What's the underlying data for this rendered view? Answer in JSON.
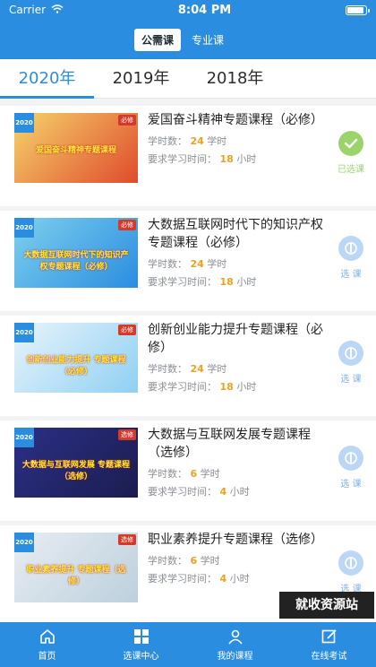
{
  "status": {
    "carrier": "Carrier",
    "time": "8:04 PM"
  },
  "segments": [
    {
      "label": "公需课",
      "active": true
    },
    {
      "label": "专业课",
      "active": false
    }
  ],
  "year_tabs": [
    {
      "label": "2020年",
      "active": true
    },
    {
      "label": "2019年",
      "active": false
    },
    {
      "label": "2018年",
      "active": false
    }
  ],
  "labels": {
    "hours_prefix": "学时数：",
    "hours_unit": "学时",
    "req_prefix": "要求学习时间：",
    "req_unit": "小时"
  },
  "courses": [
    {
      "title": "爱国奋斗精神专题课程（必修）",
      "hours": "24",
      "required": "18",
      "status_label": "已选课",
      "selected": true,
      "thumb_year": "2020",
      "thumb_tag": "必修",
      "thumb_title": "爱国奋斗精神专题课程",
      "thumb_colors": [
        "#f6d46b",
        "#e04b2d"
      ]
    },
    {
      "title": "大数据互联网时代下的知识产权专题课程（必修）",
      "hours": "24",
      "required": "18",
      "status_label": "选 课",
      "selected": false,
      "thumb_year": "2020",
      "thumb_tag": "必修",
      "thumb_title": "大数据互联网时代下的知识产权专题课程（必修）",
      "thumb_colors": [
        "#7ed0ee",
        "#2a8de0"
      ]
    },
    {
      "title": "创新创业能力提升专题课程（必修）",
      "hours": "24",
      "required": "18",
      "status_label": "选 课",
      "selected": false,
      "thumb_year": "2020",
      "thumb_tag": "必修",
      "thumb_title": "创新创业能力提升 专题课程（必修）",
      "thumb_colors": [
        "#e9f4fb",
        "#8fd0f3"
      ]
    },
    {
      "title": "大数据与互联网发展专题课程（选修）",
      "hours": "6",
      "required": "4",
      "status_label": "选 课",
      "selected": false,
      "thumb_year": "2020",
      "thumb_tag": "选修",
      "thumb_title": "大数据与互联网发展 专题课程（选修）",
      "thumb_colors": [
        "#2b2f86",
        "#1b1d4f"
      ]
    },
    {
      "title": "职业素养提升专题课程（选修）",
      "hours": "6",
      "required": "4",
      "status_label": "选 课",
      "selected": false,
      "thumb_year": "2020",
      "thumb_tag": "选修",
      "thumb_title": "职业素养提升 专题课程（选修）",
      "thumb_colors": [
        "#e8edf2",
        "#bcd0dd"
      ]
    }
  ],
  "watermark": "就收资源站",
  "tabbar": [
    {
      "label": "首页",
      "icon": "home-icon"
    },
    {
      "label": "选课中心",
      "icon": "grid-icon"
    },
    {
      "label": "我的课程",
      "icon": "user-icon"
    },
    {
      "label": "在线考试",
      "icon": "edit-icon"
    }
  ],
  "colors": {
    "primary": "#2a8de0",
    "accent_orange": "#f0a020",
    "selected_green": "#9bd46b"
  }
}
